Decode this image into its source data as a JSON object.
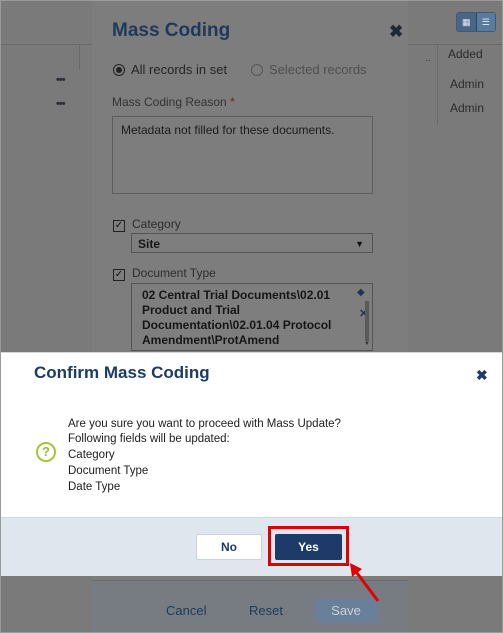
{
  "background": {
    "column_header": "Added",
    "rows": [
      "Admin",
      "Admin"
    ],
    "row_menu": "•••"
  },
  "mass_coding": {
    "title": "Mass Coding",
    "close": "✖",
    "scope_options": [
      "All records in set",
      "Selected records"
    ],
    "reason_label": "Mass Coding Reason",
    "reason_required": "*",
    "reason_value": "Metadata not filled for these documents.",
    "category_label": "Category",
    "category_value": "Site",
    "doc_type_label": "Document Type",
    "doc_type_value": "02 Central Trial Documents\\02.01 Product and Trial Documentation\\02.01.04  Protocol Amendment\\ProtAmend",
    "cancel_label": "Cancel",
    "reset_label": "Reset",
    "save_label": "Save"
  },
  "confirm": {
    "title": "Confirm Mass Coding",
    "close": "✖",
    "lines": [
      "Are you sure you want to proceed with Mass Update?",
      "Following fields will be updated:",
      "Category",
      "Document Type",
      "Date Type"
    ],
    "no_label": "No",
    "yes_label": "Yes"
  },
  "colors": {
    "accent": "#1e3a68",
    "highlight": "#e00000",
    "help": "#a7c43a"
  }
}
